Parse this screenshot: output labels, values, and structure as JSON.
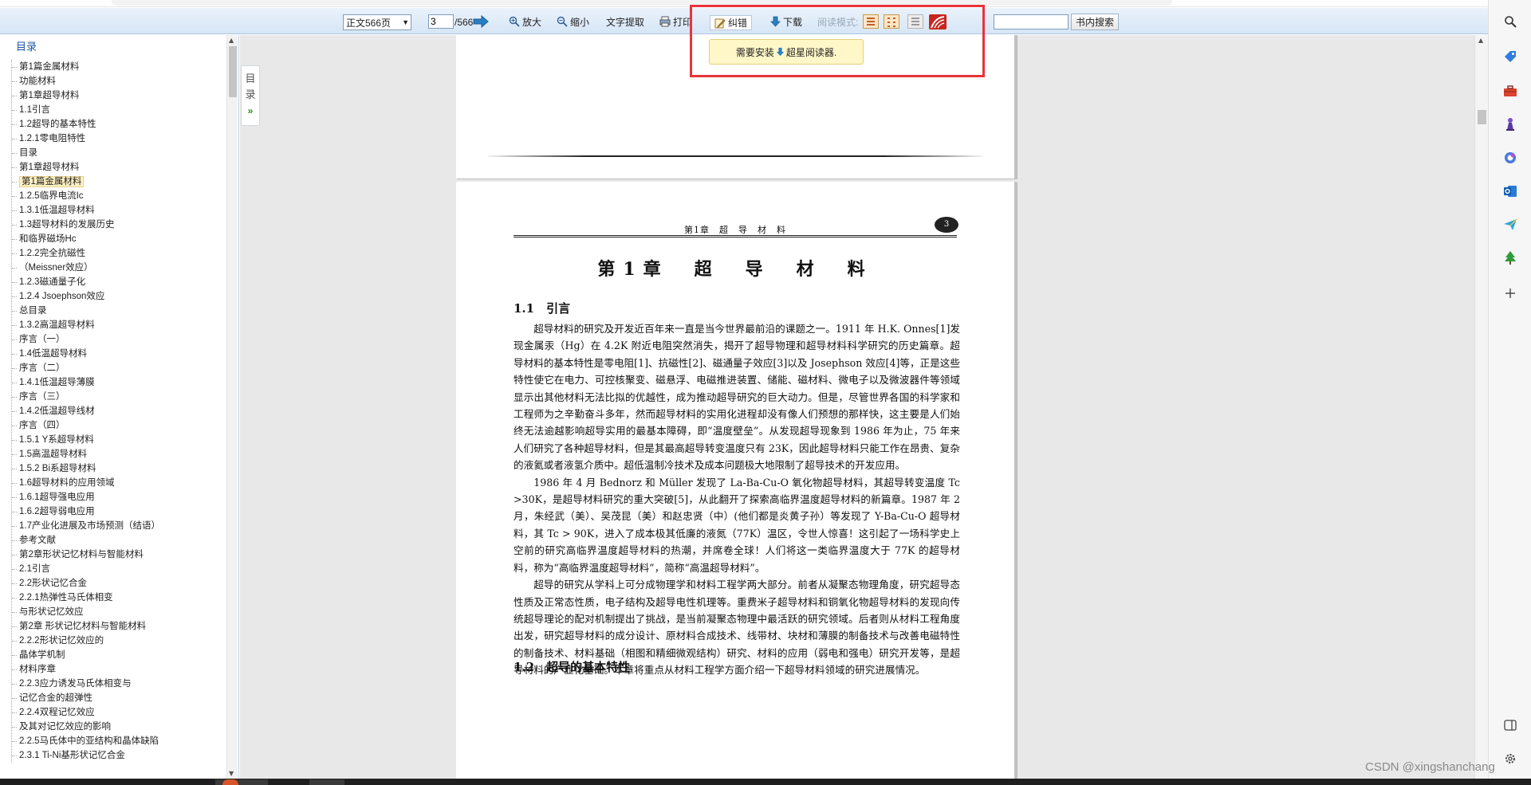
{
  "toolbar": {
    "page_select_value": "正文566页",
    "current_page": "3",
    "total_pages": "/566",
    "zoom_in": "放大",
    "zoom_out": "缩小",
    "text_extract": "文字提取",
    "print": "打印",
    "correct": "纠错",
    "download": "下载",
    "read_mode_label": "阅读模式:",
    "search_button": "书内搜索",
    "search_placeholder": ""
  },
  "tooltip": {
    "text_before": "需要安装",
    "text_after": "超星阅读器."
  },
  "sidebar": {
    "title": "目录",
    "items": [
      {
        "label": "第1篇金属材料"
      },
      {
        "label": "功能材料"
      },
      {
        "label": "第1章超导材料"
      },
      {
        "label": "1.1引言"
      },
      {
        "label": "1.2超导的基本特性"
      },
      {
        "label": "1.2.1零电阻特性"
      },
      {
        "label": "目录"
      },
      {
        "label": "第1章超导材料"
      },
      {
        "label": "第1篇金属材料",
        "selected": true
      },
      {
        "label": "1.2.5临界电流Ic"
      },
      {
        "label": "1.3.1低温超导材料"
      },
      {
        "label": "1.3超导材料的发展历史"
      },
      {
        "label": "和临界磁场Hc"
      },
      {
        "label": "1.2.2完全抗磁性"
      },
      {
        "label": "（Meissner效应）"
      },
      {
        "label": "1.2.3磁通量子化"
      },
      {
        "label": "1.2.4 Jsoephson效应"
      },
      {
        "label": "总目录"
      },
      {
        "label": "1.3.2高温超导材料"
      },
      {
        "label": "序言（一）"
      },
      {
        "label": "1.4低温超导材料"
      },
      {
        "label": "序言（二）"
      },
      {
        "label": "1.4.1低温超导薄膜"
      },
      {
        "label": "序言（三）"
      },
      {
        "label": "1.4.2低温超导线材"
      },
      {
        "label": "序言（四）"
      },
      {
        "label": "1.5.1 Y系超导材料"
      },
      {
        "label": "1.5高温超导材料"
      },
      {
        "label": "1.5.2 Bi系超导材料"
      },
      {
        "label": "1.6超导材料的应用领域"
      },
      {
        "label": "1.6.1超导强电应用"
      },
      {
        "label": "1.6.2超导弱电应用"
      },
      {
        "label": "1.7产业化进展及市场预测（结语）"
      },
      {
        "label": "参考文献"
      },
      {
        "label": "第2章形状记忆材料与智能材料"
      },
      {
        "label": "2.1引言"
      },
      {
        "label": "2.2形状记忆合金"
      },
      {
        "label": "2.2.1热弹性马氏体相变"
      },
      {
        "label": "与形状记忆效应"
      },
      {
        "label": "第2章 形状记忆材料与智能材料"
      },
      {
        "label": "2.2.2形状记忆效应的"
      },
      {
        "label": "晶体学机制"
      },
      {
        "label": "材料序章"
      },
      {
        "label": "2.2.3应力诱发马氏体相变与"
      },
      {
        "label": "记忆合金的超弹性"
      },
      {
        "label": "2.2.4双程记忆效应"
      },
      {
        "label": "及其对记忆效应的影响"
      },
      {
        "label": "2.2.5马氏体中的亚结构和晶体缺陷"
      },
      {
        "label": "2.3.1 Ti-Ni基形状记忆合金"
      }
    ]
  },
  "toc_tab": {
    "line1": "目",
    "line2": "录",
    "chevron": "»"
  },
  "document": {
    "running_header": "第1章　超　导　材　料",
    "page_number": "3",
    "chapter_title": "第1章　超　导　材　料",
    "section_1_1": "1.1　引言",
    "paragraphs": [
      "超导材料的研究及开发近百年来一直是当今世界最前沿的课题之一。1911 年 H.K. Onnes[1]发现金属汞（Hg）在 4.2K 附近电阻突然消失，揭开了超导物理和超导材料科学研究的历史篇章。超导材料的基本特性是零电阻[1]、抗磁性[2]、磁通量子效应[3]以及 Josephson 效应[4]等，正是这些特性使它在电力、可控核聚变、磁悬浮、电磁推进装置、储能、磁材料、微电子以及微波器件等领域显示出其他材料无法比拟的优越性，成为推动超导研究的巨大动力。但是，尽管世界各国的科学家和工程师为之辛勤奋斗多年，然而超导材料的实用化进程却没有像人们预想的那样快，这主要是人们始终无法逾越影响超导实用的最基本障碍，即“温度壁垒”。从发现超导现象到 1986 年为止，75 年来人们研究了各种超导材料，但是其最高超导转变温度只有 23K，因此超导材料只能工作在昂贵、复杂的液氦或者液氢介质中。超低温制冷技术及成本问题极大地限制了超导技术的开发应用。",
      "1986 年 4 月 Bednorz 和 Müller 发现了 La-Ba-Cu-O 氧化物超导材料，其超导转变温度 Tc >30K，是超导材料研究的重大突破[5]，从此翻开了探索高临界温度超导材料的新篇章。1987 年 2 月，朱经武（美）、吴茂昆（美）和赵忠贤（中）(他们都是炎黄子孙）等发现了 Y-Ba-Cu-O 超导材料，其 Tc > 90K，进入了成本极其低廉的液氮（77K）温区，令世人惊喜！这引起了一场科学史上空前的研究高临界温度超导材料的热潮，并席卷全球！人们将这一类临界温度大于 77K 的超导材料，称为“高临界温度超导材料”，简称“高温超导材料”。",
      "超导的研究从学科上可分成物理学和材料工程学两大部分。前者从凝聚态物理角度，研究超导态性质及正常态性质，电子结构及超导电性机理等。重费米子超导材料和铜氧化物超导材料的发现向传统超导理论的配对机制提出了挑战，是当前凝聚态物理中最活跃的研究领域。后者则从材料工程角度出发，研究超导材料的成分设计、原材料合成技术、线带材、块材和薄膜的制备技术与改善电磁特性的制备技术、材料基础（相图和精细微观结构）研究、材料的应用（弱电和强电）研究开发等，是超导材料的产业化基础。本章将重点从材料工程学方面介绍一下超导材料领域的研究进展情况。"
    ],
    "section_1_2": "1.2　超导的基本特性"
  },
  "watermark": "CSDN @xingshanchang",
  "colors": {
    "toolbar_bg": "#d6e6f6",
    "toc_title": "#1c56a8",
    "highlight_border": "#e8343a",
    "tooltip_bg": "#fff7c8",
    "selected_toc_bg": "#fff1c2"
  },
  "icons": {
    "zoom_in": "zoom-in-icon",
    "zoom_out": "zoom-out-icon",
    "print": "printer-icon",
    "correct": "edit-icon",
    "download": "download-arrow-icon",
    "go": "go-arrow-icon"
  }
}
